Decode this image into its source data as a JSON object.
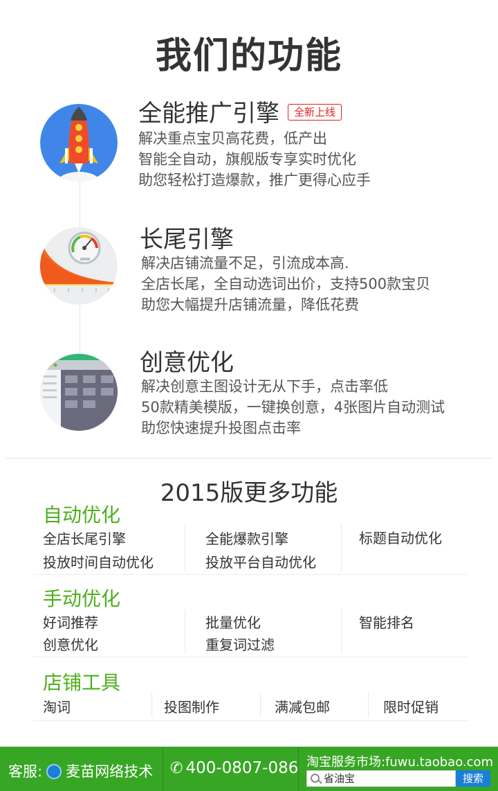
{
  "page_title": "我们的功能",
  "features": [
    {
      "title": "全能推广引擎",
      "badge": "全新上线",
      "lines": [
        "解决重点宝贝高花费，低产出",
        "智能全自动，旗舰版专享实时优化",
        "助您轻松打造爆款，推广更得心应手"
      ],
      "icon": "rocket-icon"
    },
    {
      "title": "长尾引擎",
      "lines": [
        "解决店铺流量不足，引流成本高.",
        "全店长尾，全自动选词出价，支持500款宝贝",
        "助您大幅提升店铺流量，降低花费"
      ],
      "icon": "speedometer-icon"
    },
    {
      "title": "创意优化",
      "lines": [
        "解决创意主图设计无从下手，点击率低",
        "50款精美模版，一键换创意，4张图片自动测试",
        "助您快速提升投图点击率"
      ],
      "icon": "template-grid-icon"
    }
  ],
  "more_title": "2015版更多功能",
  "categories": [
    {
      "label": "自动优化",
      "col1": [
        "全店长尾引擎",
        "投放时间自动优化"
      ],
      "col2": [
        "全能爆款引擎",
        "投放平台自动优化"
      ],
      "col3": [
        "标题自动优化"
      ]
    },
    {
      "label": "手动优化",
      "col1": [
        "好词推荐",
        "创意优化"
      ],
      "col2": [
        "批量优化",
        "重复词过滤"
      ],
      "col3": [
        "智能排名"
      ]
    },
    {
      "label": "店铺工具",
      "items": [
        "淘词",
        "投图制作",
        "满减包邮",
        "限时促销"
      ]
    }
  ],
  "footer": {
    "kefu_label": "客服:",
    "company": "麦苗网络技术",
    "phone": "400-0807-086",
    "market": "淘宝服务市场:fuwu.taobao.com",
    "search_value": "省油宝",
    "search_button": "搜索"
  },
  "colors": {
    "accent_green": "#4caf1c",
    "footer_green": "#37a624",
    "badge_red": "#e02020",
    "search_blue": "#1a7fd6"
  }
}
